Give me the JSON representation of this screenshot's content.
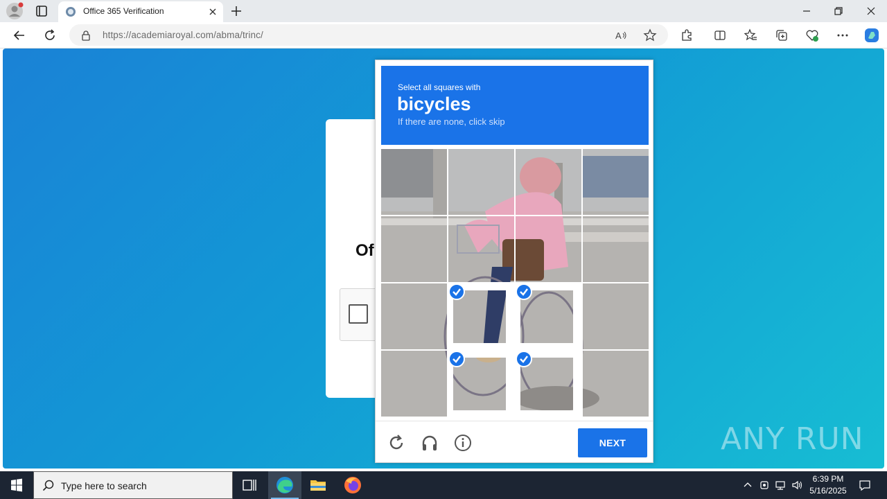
{
  "browser": {
    "tab_title": "Office 365 Verification",
    "url_domain": "https://academiaroyal.com",
    "url_path": "/abma/trinc/"
  },
  "page": {
    "heading": "Of",
    "watermark": "ANY RUN"
  },
  "captcha": {
    "prompt_line1": "Select all squares with",
    "target": "bicycles",
    "prompt_line3": "If there are none, click skip",
    "grid_size": 4,
    "selected_tiles": [
      9,
      10,
      13,
      14
    ],
    "next_label": "NEXT",
    "accent_color": "#1a73e8"
  },
  "taskbar": {
    "search_placeholder": "Type here to search",
    "time": "6:39 PM",
    "date": "5/16/2025"
  }
}
